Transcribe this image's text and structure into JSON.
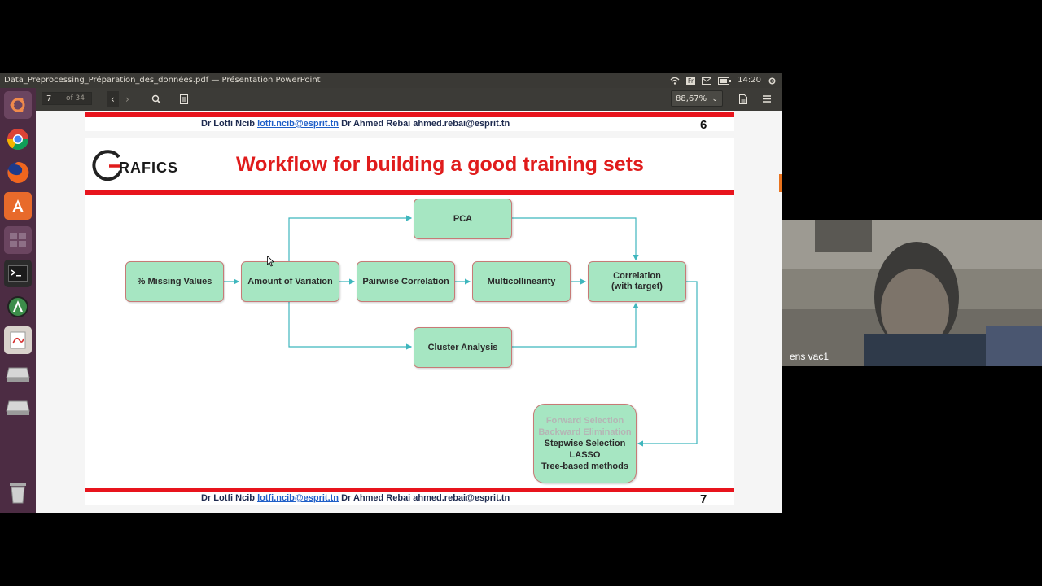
{
  "window": {
    "title": "Data_Preprocessing_Préparation_des_données.pdf — Présentation PowerPoint"
  },
  "tray": {
    "keyboard": "Fr",
    "time": "14:20"
  },
  "launcher": {
    "items": [
      "ubuntu-logo-icon",
      "chrome-icon",
      "firefox-icon",
      "software-center-icon",
      "workspaces-icon",
      "terminal-icon",
      "software-updater-icon",
      "document-viewer-icon",
      "drive-icon",
      "drive-icon",
      "trash-icon"
    ]
  },
  "viewer": {
    "page_input": "7",
    "page_total": "of 34",
    "zoom": "88,67%"
  },
  "slide6": {
    "footer_authors_a": "Dr Lotfi Ncib",
    "footer_email": "lotfi.ncib@esprit.tn",
    "footer_authors_b": "Dr Ahmed Rebai ahmed.rebai@esprit.tn",
    "page_number": "6"
  },
  "slide7": {
    "logo_text": "RAFICS",
    "title": "Workflow for building a good training sets",
    "boxes": {
      "missing": "% Missing Values",
      "variation": "Amount of Variation",
      "pairwise": "Pairwise Correlation",
      "multicol": "Multicollinearity",
      "correlation_1": "Correlation",
      "correlation_2": "(with target)",
      "pca": "PCA",
      "cluster": "Cluster Analysis"
    },
    "selection": {
      "forward": "Forward Selection",
      "backward": "Backward Elimination",
      "stepwise": "Stepwise Selection",
      "lasso": "LASSO",
      "tree": "Tree-based methods"
    },
    "footer_authors_a": "Dr Lotfi Ncib",
    "footer_email": "lotfi.ncib@esprit.tn",
    "footer_authors_b": "Dr Ahmed Rebai ahmed.rebai@esprit.tn",
    "page_number": "7"
  },
  "video": {
    "participant": "ens vac1"
  },
  "colors": {
    "accent_red": "#e8141d",
    "box_green": "#a6e6c2",
    "arrow_teal": "#3fb6bd",
    "launcher": "#4c2c43"
  }
}
